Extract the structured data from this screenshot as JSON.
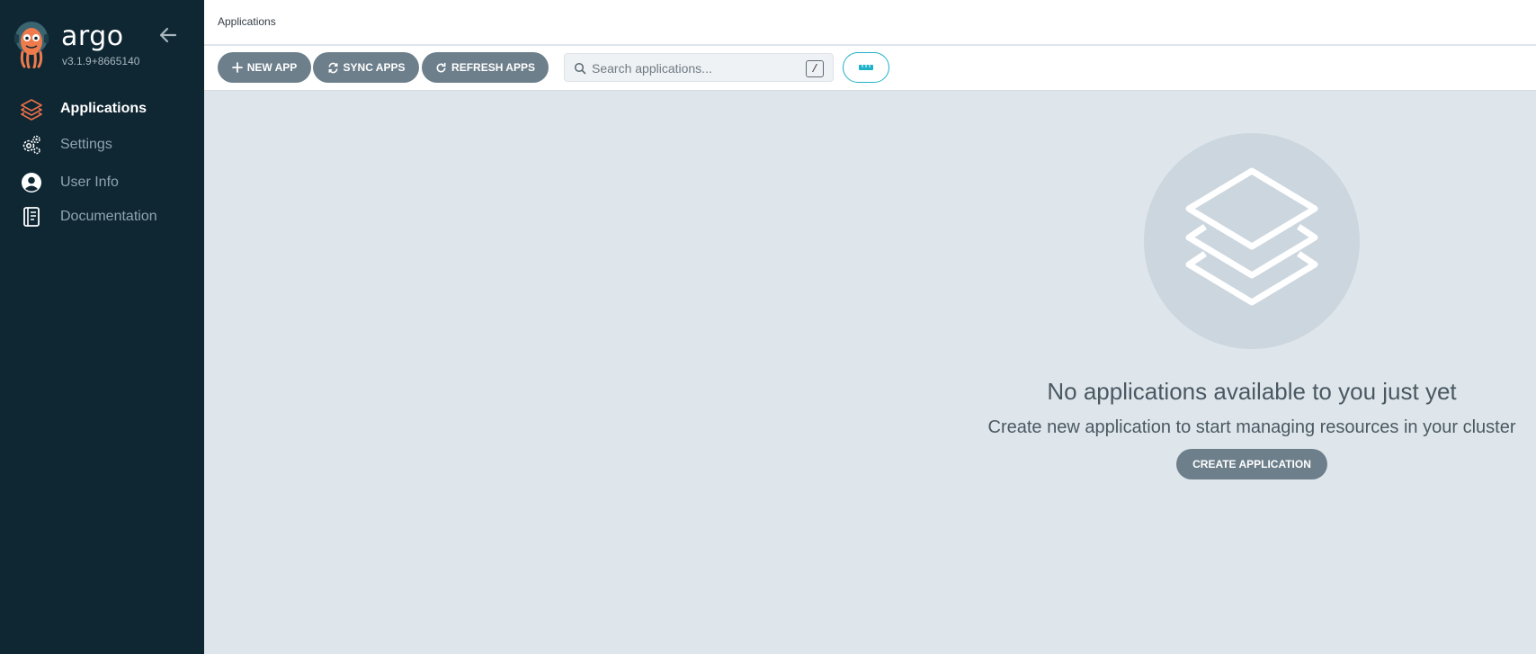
{
  "app": {
    "brand": "argo",
    "version": "v3.1.9+8665140"
  },
  "sidebar": {
    "items": [
      {
        "label": "Applications",
        "icon": "layers-icon",
        "active": true
      },
      {
        "label": "Settings",
        "icon": "gears-icon",
        "active": false
      },
      {
        "label": "User Info",
        "icon": "user-circle-icon",
        "active": false
      },
      {
        "label": "Documentation",
        "icon": "book-icon",
        "active": false
      }
    ]
  },
  "header": {
    "title": "Applications"
  },
  "toolbar": {
    "new_app_label": "NEW APP",
    "sync_apps_label": "SYNC APPS",
    "refresh_apps_label": "REFRESH APPS",
    "search_placeholder": "Search applications...",
    "search_shortcut": "/",
    "view_icon": "view-tiles-icon"
  },
  "empty_state": {
    "icon": "layers-icon",
    "title": "No applications available to you just yet",
    "subtitle": "Create new application to start managing resources in your cluster",
    "create_label": "CREATE APPLICATION"
  },
  "colors": {
    "sidebar_bg": "#0f2733",
    "content_bg": "#dee6eb",
    "button_bg": "#6d7f8b",
    "accent": "#1eb2c8",
    "active_icon": "#ec7048"
  }
}
